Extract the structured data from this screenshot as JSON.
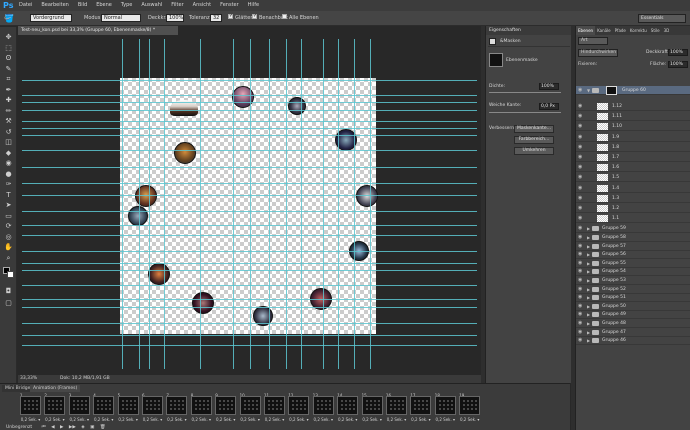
{
  "app": {
    "logo": "Ps",
    "menus": [
      "Datei",
      "Bearbeiten",
      "Bild",
      "Ebene",
      "Type",
      "Auswahl",
      "Filter",
      "Ansicht",
      "Fenster",
      "Hilfe"
    ]
  },
  "options": {
    "layer_select": "Vordergrund",
    "mode_label": "Modus:",
    "mode_value": "Normal",
    "opacity_label": "Deckkr.:",
    "opacity_value": "100%",
    "tolerance_label": "Toleranz:",
    "tolerance_value": "32",
    "smooth_label": "Glätten",
    "contiguous_label": "Benachbart",
    "all_layers_label": "Alle Ebenen",
    "workspace": "Essentials"
  },
  "document": {
    "tab_title": "Test-neu_kon.psd bei 33,3% (Gruppe 60, Ebenenmaske/8) *",
    "zoom": "33,33%",
    "doc_info": "Dok: 10,2 MB/1,91 GB"
  },
  "timeline": {
    "tab1": "Mini Bridge",
    "tab2": "Animation (Frames)",
    "frame_delay": "0,2 Sek.",
    "loop": "Unbegrenzt"
  },
  "properties": {
    "header": "Eigenschaften",
    "mask_title": "&Masken",
    "layer_mask": "Ebenenmaske",
    "density_label": "Dichte:",
    "density_value": "100%",
    "feather_label": "Weiche Kante:",
    "feather_value": "0,0 Px",
    "refine_label": "Verbessern:",
    "btn_mask_edge": "Maskenkante...",
    "btn_color_range": "Farbbereich...",
    "btn_invert": "Umkehren"
  },
  "layers": {
    "tabs": [
      "Ebenen",
      "Kanäle",
      "Pfade",
      "Korrektu",
      "Stile",
      "3D"
    ],
    "filter": "Art",
    "blend": "Hindurchwirken",
    "opacity_label": "Deckkraft:",
    "opacity_value": "100%",
    "lock_label": "Fixieren:",
    "fill_label": "Fläche:",
    "fill_value": "100%",
    "group_selected": "Gruppe 60",
    "sublayers": [
      "1.12",
      "1.11",
      "1.10",
      "1.9",
      "1.8",
      "1.7",
      "1.6",
      "1.5",
      "1.4",
      "1.3",
      "1.2",
      "1.1"
    ],
    "groups": [
      "Gruppe 59",
      "Gruppe 58",
      "Gruppe 57",
      "Gruppe 56",
      "Gruppe 55",
      "Gruppe 54",
      "Gruppe 53",
      "Gruppe 52",
      "Gruppe 51",
      "Gruppe 50",
      "Gruppe 49",
      "Gruppe 48",
      "Gruppe 47",
      "Gruppe 46"
    ]
  },
  "colors": {
    "guides": "#5cc6d0",
    "accent": "#31a8ff"
  }
}
